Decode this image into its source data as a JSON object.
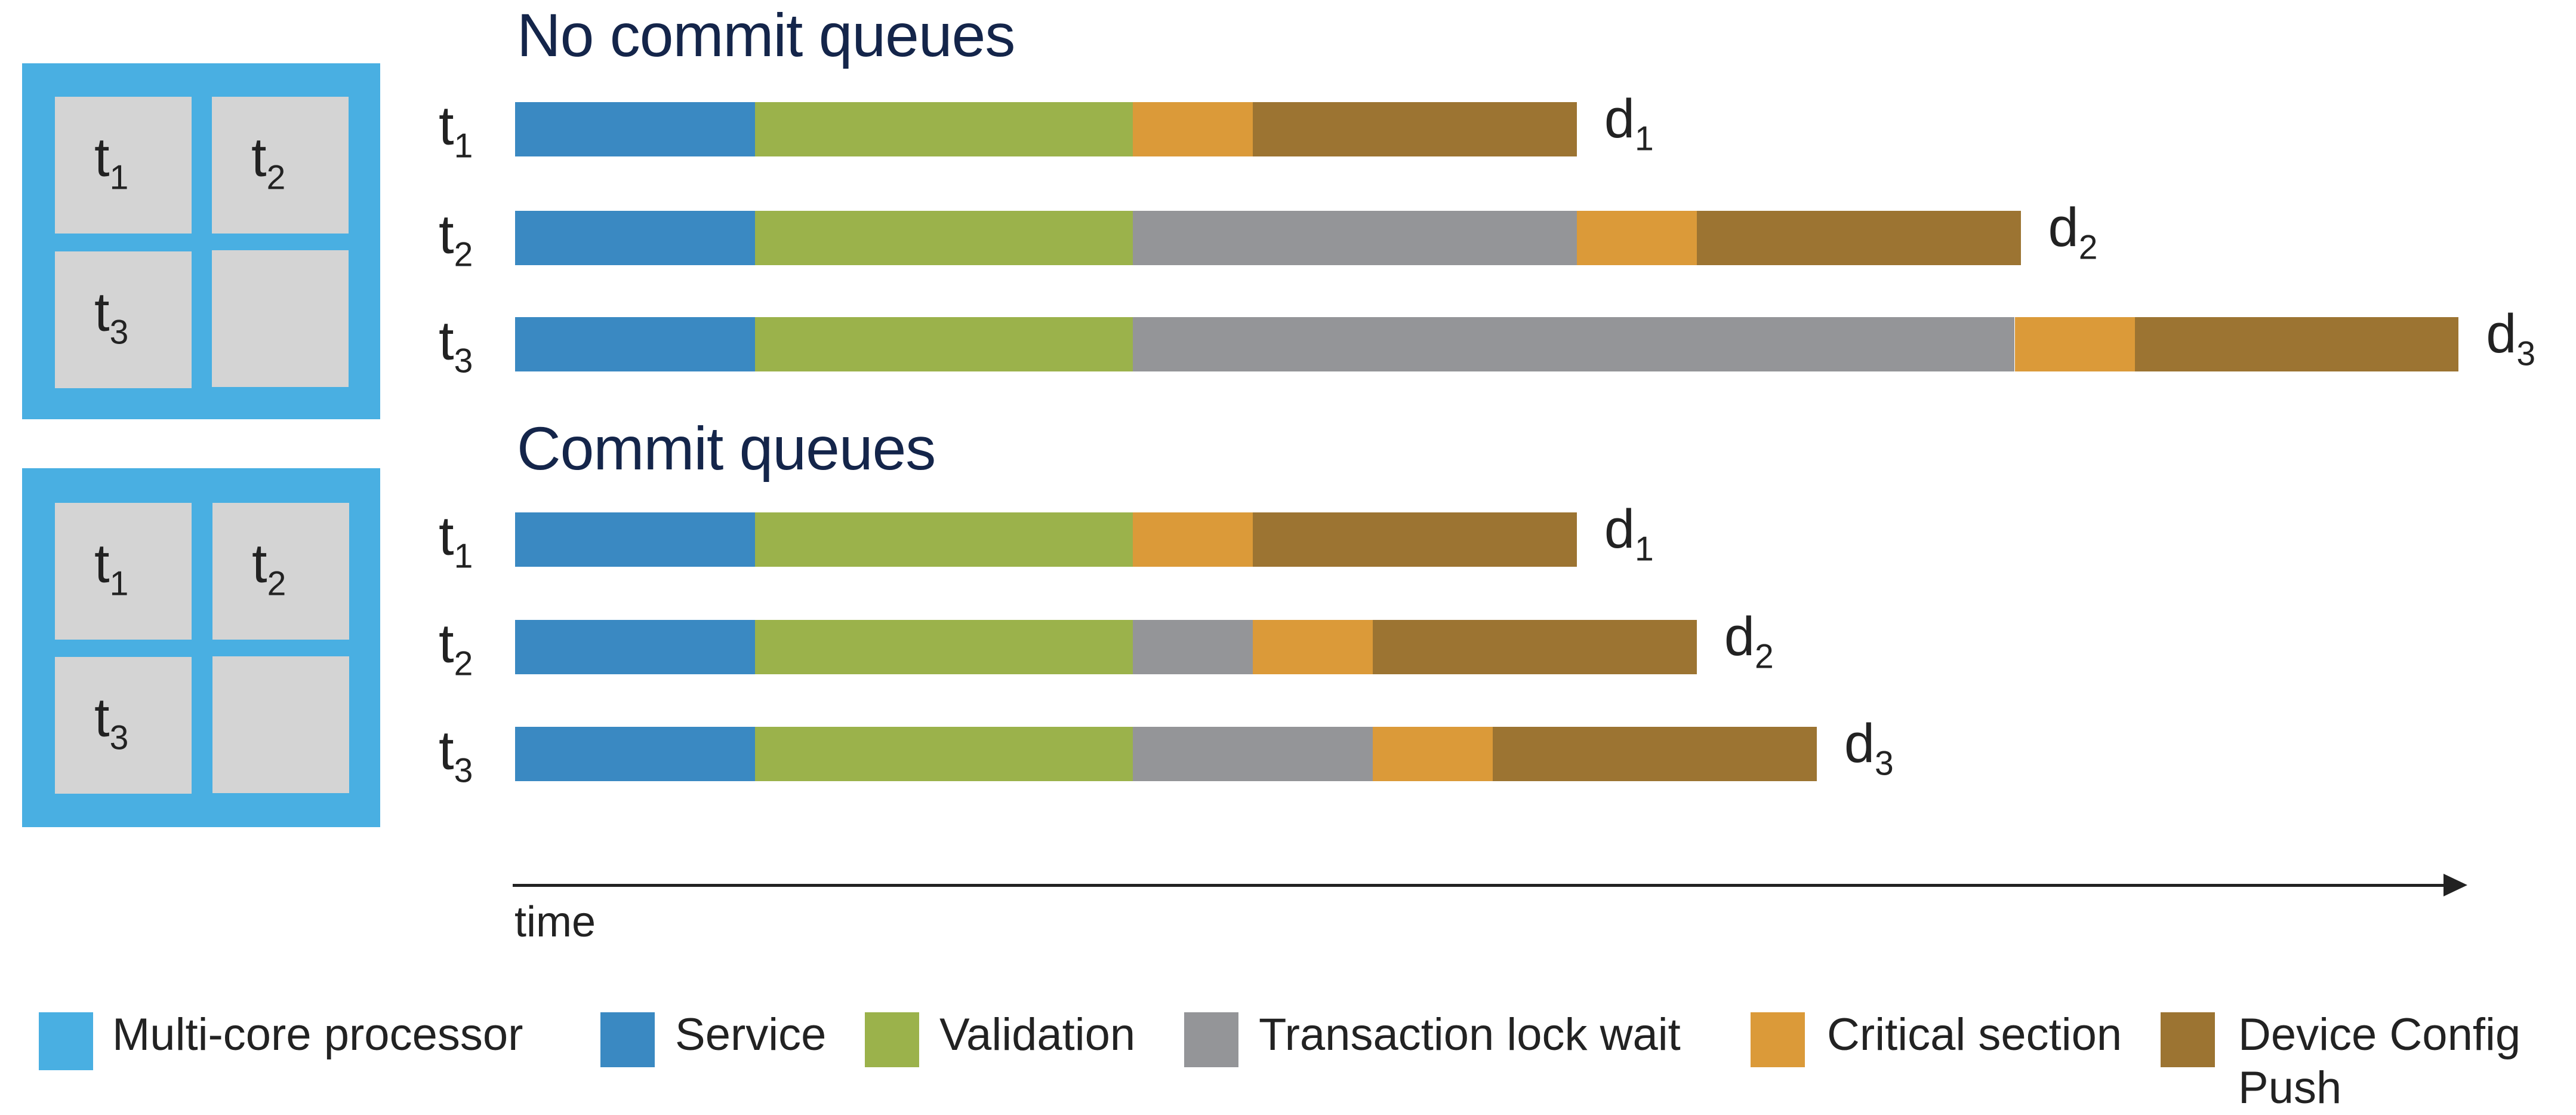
{
  "colors": {
    "multi_core_processor": "#49afe2",
    "core": "#d4d4d4",
    "service": "#3a89c2",
    "validation": "#9bb24b",
    "lock_wait": "#949598",
    "critical_section": "#db9a39",
    "device_config_push": "#9c7432",
    "title": "#14254a",
    "axis": "#222222"
  },
  "processors": [
    {
      "cores": [
        {
          "label": "t",
          "sub": "1"
        },
        {
          "label": "t",
          "sub": "2"
        },
        {
          "label": "t",
          "sub": "3"
        },
        {
          "label": "",
          "sub": ""
        }
      ]
    },
    {
      "cores": [
        {
          "label": "t",
          "sub": "1"
        },
        {
          "label": "t",
          "sub": "2"
        },
        {
          "label": "t",
          "sub": "3"
        },
        {
          "label": "",
          "sub": ""
        }
      ]
    }
  ],
  "chart_data": {
    "type": "bar",
    "subtype": "stacked-horizontal-timeline",
    "xlabel": "time",
    "units": "relative time units (Critical section = 1)",
    "segment_order": [
      "Service",
      "Validation",
      "Transaction lock wait",
      "Critical section",
      "Device Config Push"
    ],
    "panels": [
      {
        "title": "No commit queues",
        "rows": [
          {
            "label": "t",
            "sub": "1",
            "end_label": "d",
            "end_sub": "1",
            "segments": {
              "Service": 2.0,
              "Validation": 3.15,
              "Transaction lock wait": 0,
              "Critical section": 1.0,
              "Device Config Push": 2.7
            }
          },
          {
            "label": "t",
            "sub": "2",
            "end_label": "d",
            "end_sub": "2",
            "segments": {
              "Service": 2.0,
              "Validation": 3.15,
              "Transaction lock wait": 3.7,
              "Critical section": 1.0,
              "Device Config Push": 2.7
            }
          },
          {
            "label": "t",
            "sub": "3",
            "end_label": "d",
            "end_sub": "3",
            "segments": {
              "Service": 2.0,
              "Validation": 3.15,
              "Transaction lock wait": 7.35,
              "Critical section": 1.0,
              "Device Config Push": 2.7
            }
          }
        ]
      },
      {
        "title": "Commit queues",
        "rows": [
          {
            "label": "t",
            "sub": "1",
            "end_label": "d",
            "end_sub": "1",
            "segments": {
              "Service": 2.0,
              "Validation": 3.15,
              "Transaction lock wait": 0,
              "Critical section": 1.0,
              "Device Config Push": 2.7
            }
          },
          {
            "label": "t",
            "sub": "2",
            "end_label": "d",
            "end_sub": "2",
            "segments": {
              "Service": 2.0,
              "Validation": 3.15,
              "Transaction lock wait": 1.0,
              "Critical section": 1.0,
              "Device Config Push": 2.7
            }
          },
          {
            "label": "t",
            "sub": "3",
            "end_label": "d",
            "end_sub": "3",
            "segments": {
              "Service": 2.0,
              "Validation": 3.15,
              "Transaction lock wait": 2.0,
              "Critical section": 1.0,
              "Device Config Push": 2.7
            }
          }
        ]
      }
    ],
    "legend": [
      {
        "label": "Multi-core processor",
        "color": "#49afe2"
      },
      {
        "label": "Service",
        "color": "#3a89c2"
      },
      {
        "label": "Validation",
        "color": "#9bb24b"
      },
      {
        "label": "Transaction lock wait",
        "color": "#949598"
      },
      {
        "label": "Critical section",
        "color": "#db9a39"
      },
      {
        "label": "Device Config Push",
        "color": "#9c7432"
      }
    ],
    "legend_position": "bottom"
  }
}
